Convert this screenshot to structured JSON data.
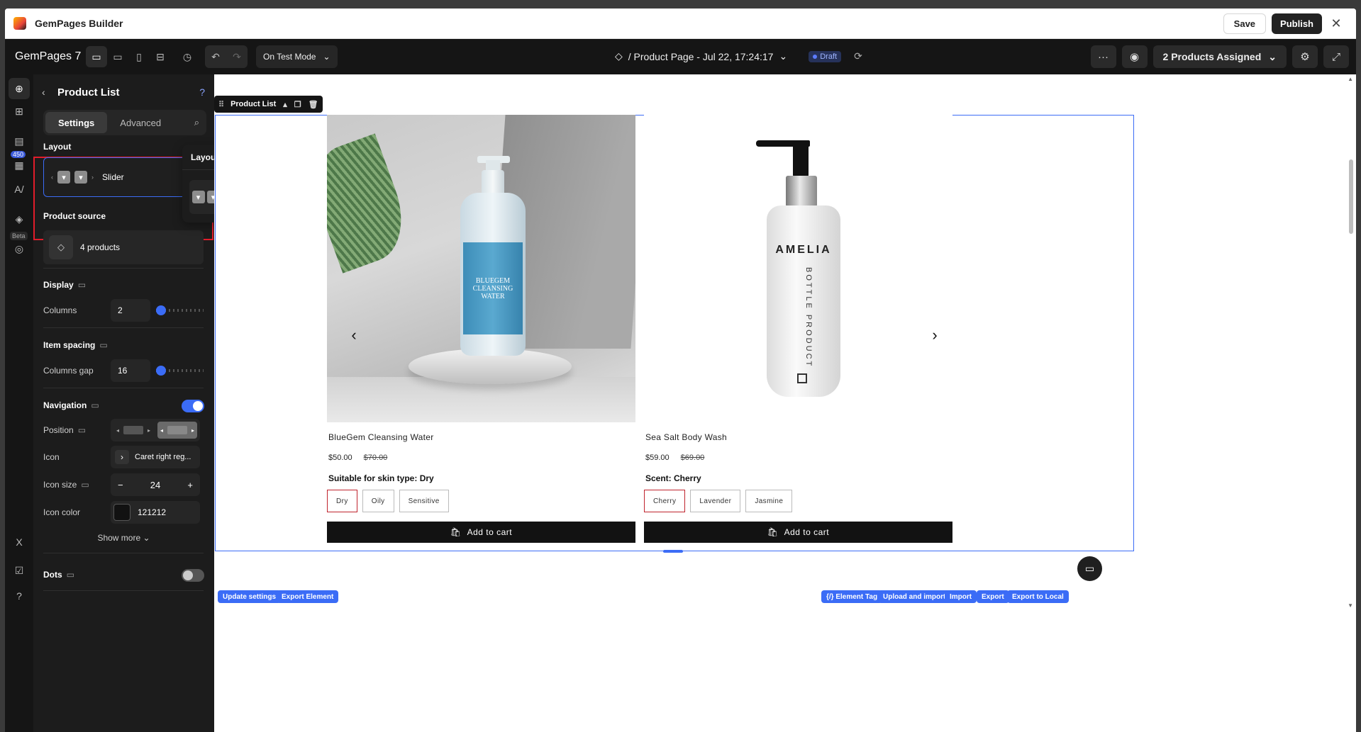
{
  "window": {
    "title": "GemPages Builder",
    "save_label": "Save",
    "publish_label": "Publish",
    "close_glyph": "✕"
  },
  "toolbar": {
    "brand": "GemPages 7",
    "mode": "On Test Mode",
    "page_title": "/ Product Page - Jul 22, 17:24:17",
    "status": "Draft",
    "assign_label": "2 Products Assigned"
  },
  "rail": {
    "badge_count": "450",
    "beta_label": "Beta"
  },
  "panel": {
    "title": "Product List",
    "tabs": [
      "Settings",
      "Advanced"
    ],
    "layout_label": "Layout",
    "layout_value": "Slider",
    "product_source_label": "Product source",
    "product_source_value": "4 products",
    "display_label": "Display",
    "columns_label": "Columns",
    "columns_value": "2",
    "columns_fraction": 0.1,
    "item_spacing_label": "Item spacing",
    "columns_gap_label": "Columns gap",
    "columns_gap_value": "16",
    "columns_gap_fraction": 0.1,
    "navigation_label": "Navigation",
    "navigation_on": true,
    "position_label": "Position",
    "icon_label": "Icon",
    "icon_value": "Caret right reg...",
    "icon_size_label": "Icon size",
    "icon_size_value": "24",
    "icon_color_label": "Icon color",
    "icon_color_value": "121212",
    "show_more_label": "Show more",
    "dots_label": "Dots",
    "dots_on": false,
    "accent_color": "#3b6cf6"
  },
  "popover": {
    "title": "Layout"
  },
  "canvas": {
    "element_tag": "Product List",
    "products": [
      {
        "name": "BlueGem Cleansing Water",
        "price": "$50.00",
        "compare_price": "$70.00",
        "option_title": "Suitable for skin type: Dry",
        "options": [
          "Dry",
          "Oily",
          "Sensitive"
        ],
        "selected": 0,
        "bottle_label": "BLUEGEM CLEANSING WATER",
        "cart_label": "Add to cart"
      },
      {
        "name": "Sea Salt Body Wash",
        "price": "$59.00",
        "compare_price": "$69.00",
        "option_title": "Scent: Cherry",
        "options": [
          "Cherry",
          "Lavender",
          "Jasmine"
        ],
        "selected": 0,
        "bottle_brand": "AMELIA",
        "bottle_sub": "BOTTLE PRODUCT",
        "cart_label": "Add to cart"
      }
    ],
    "bottom_left_buttons": [
      "Update settings",
      "Export Element"
    ],
    "bottom_right_buttons": [
      "{/} Element Tag",
      "Upload and import",
      "Import",
      "Export",
      "Export to Local"
    ]
  }
}
